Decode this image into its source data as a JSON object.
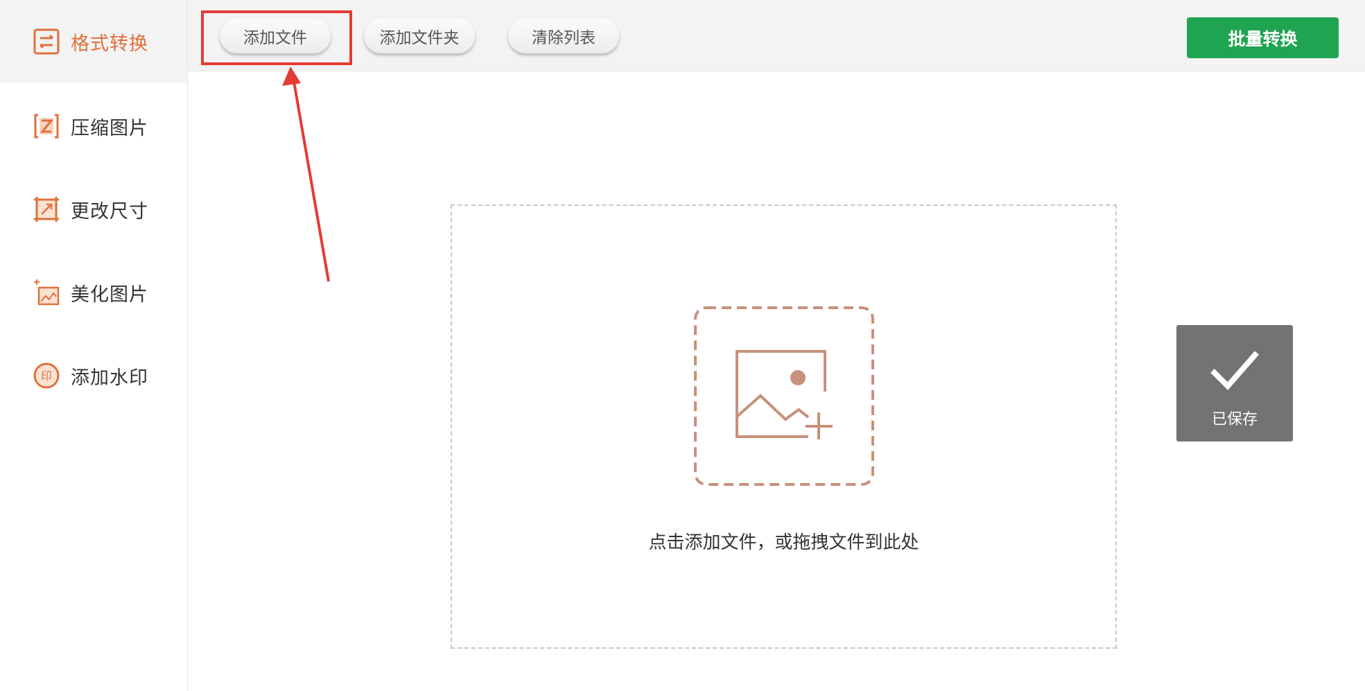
{
  "sidebar": {
    "items": [
      {
        "label": "格式转换",
        "icon": "format-convert-icon",
        "active": true
      },
      {
        "label": "压缩图片",
        "icon": "compress-icon",
        "active": false
      },
      {
        "label": "更改尺寸",
        "icon": "resize-icon",
        "active": false
      },
      {
        "label": "美化图片",
        "icon": "beautify-icon",
        "active": false
      },
      {
        "label": "添加水印",
        "icon": "watermark-icon",
        "active": false
      }
    ]
  },
  "toolbar": {
    "add_file_label": "添加文件",
    "add_folder_label": "添加文件夹",
    "clear_list_label": "清除列表",
    "batch_convert_label": "批量转换"
  },
  "dropzone": {
    "icon": "add-image-icon",
    "hint": "点击添加文件，或拖拽文件到此处"
  },
  "toast": {
    "icon": "checkmark-icon",
    "text": "已保存"
  },
  "colors": {
    "accent": "#e0703a",
    "batch_button": "#1fa551",
    "highlight": "#e63a35",
    "dropzone_icon": "#c8917a",
    "toast_bg": "#737373"
  }
}
